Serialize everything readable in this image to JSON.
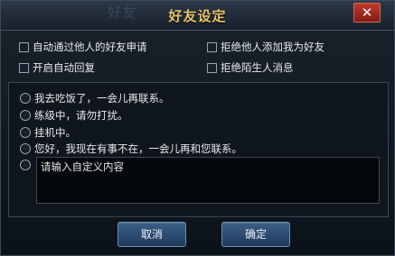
{
  "dialog": {
    "background_title": "好友",
    "title": "好友设定",
    "close_label": "✕"
  },
  "options": [
    {
      "label": "自动通过他人的好友申请",
      "checked": false
    },
    {
      "label": "拒绝他人添加我为好友",
      "checked": false
    },
    {
      "label": "开启自动回复",
      "checked": false
    },
    {
      "label": "拒绝陌生人消息",
      "checked": false
    }
  ],
  "replies": [
    {
      "label": "我去吃饭了，一会儿再联系。"
    },
    {
      "label": "练级中，请勿打扰。"
    },
    {
      "label": "挂机中。"
    },
    {
      "label": "您好，我现在有事不在，一会儿再和您联系。"
    }
  ],
  "custom_reply": {
    "text": "请输入自定义内容"
  },
  "buttons": {
    "cancel": "取消",
    "confirm": "确定"
  }
}
